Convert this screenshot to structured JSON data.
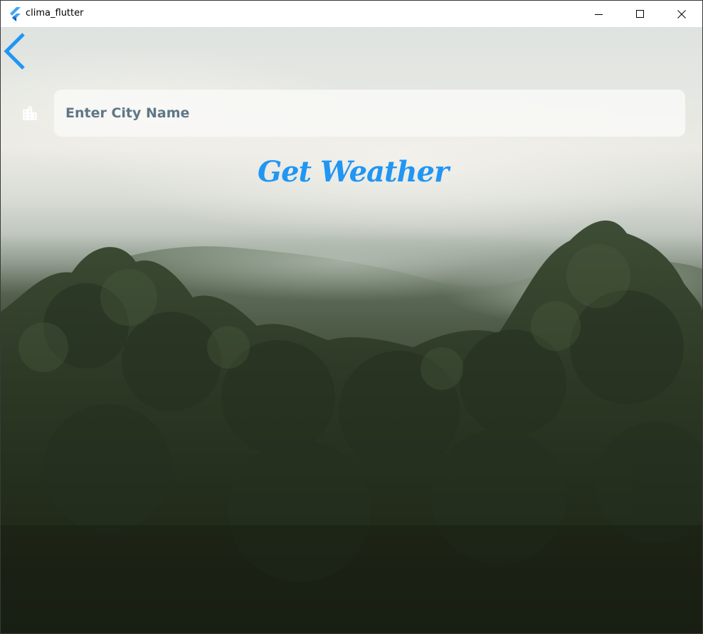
{
  "window": {
    "title": "clima_flutter",
    "app_icon": "flutter-logo-icon",
    "controls": {
      "minimize_icon": "minimize-icon",
      "maximize_icon": "maximize-icon",
      "close_icon": "close-icon"
    }
  },
  "screen": {
    "back_icon": "chevron-left-icon",
    "city_icon": "location-city-icon",
    "city_input": {
      "placeholder": "Enter City Name",
      "value": ""
    },
    "get_weather_label": "Get Weather",
    "background": "misty-forest-image"
  },
  "colors": {
    "accent": "#2196F3",
    "input_text": "#5F7787",
    "input_fill": "#F8F8F6",
    "icon_white": "#FFFFFF"
  }
}
